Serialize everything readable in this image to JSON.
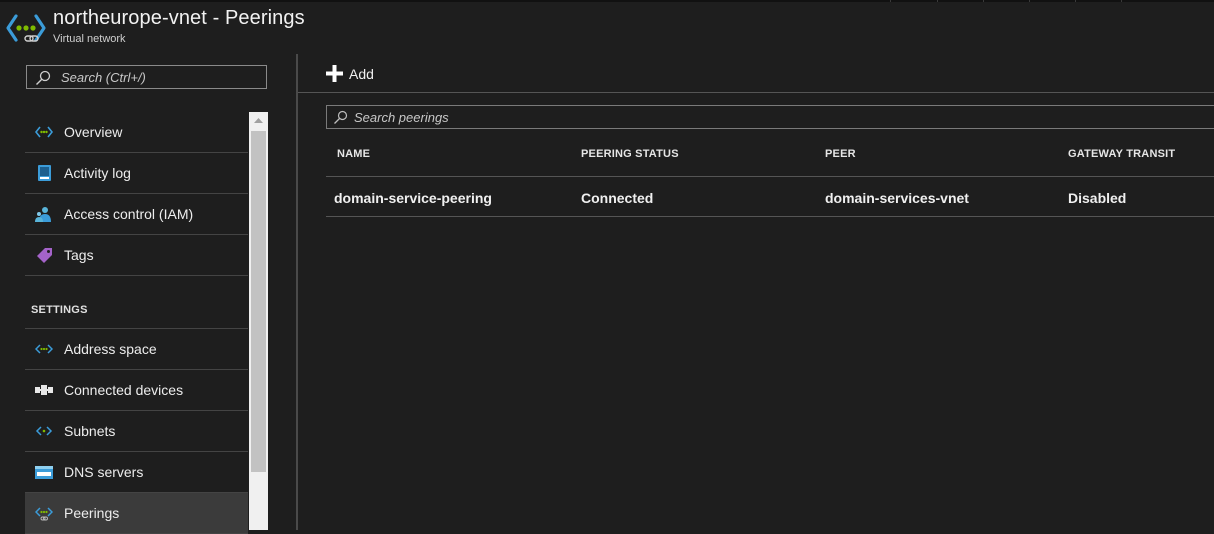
{
  "header": {
    "title": "northeurope-vnet - Peerings",
    "subtitle": "Virtual network"
  },
  "sidebar": {
    "search": {
      "placeholder": "Search (Ctrl+/)"
    },
    "items": [
      {
        "label": "Overview",
        "icon": "vnet-icon"
      },
      {
        "label": "Activity log",
        "icon": "activity-log-icon"
      },
      {
        "label": "Access control (IAM)",
        "icon": "iam-icon"
      },
      {
        "label": "Tags",
        "icon": "tag-icon"
      }
    ],
    "section_settings": "SETTINGS",
    "settings_items": [
      {
        "label": "Address space",
        "icon": "address-space-icon"
      },
      {
        "label": "Connected devices",
        "icon": "connected-devices-icon"
      },
      {
        "label": "Subnets",
        "icon": "subnets-icon"
      },
      {
        "label": "DNS servers",
        "icon": "dns-icon"
      },
      {
        "label": "Peerings",
        "icon": "peerings-icon",
        "active": true
      }
    ]
  },
  "main": {
    "add_label": "Add",
    "search": {
      "placeholder": "Search peerings"
    },
    "table": {
      "columns": [
        "NAME",
        "PEERING STATUS",
        "PEER",
        "GATEWAY TRANSIT"
      ],
      "rows": [
        [
          "domain-service-peering",
          "Connected",
          "domain-services-vnet",
          "Disabled"
        ]
      ]
    }
  },
  "colors": {
    "background": "#1e1e1e",
    "active_item": "#3b3b3b",
    "azure_blue": "#3b9cd9",
    "dot_green": "#7fba00",
    "tag_purple": "#a463c9"
  }
}
